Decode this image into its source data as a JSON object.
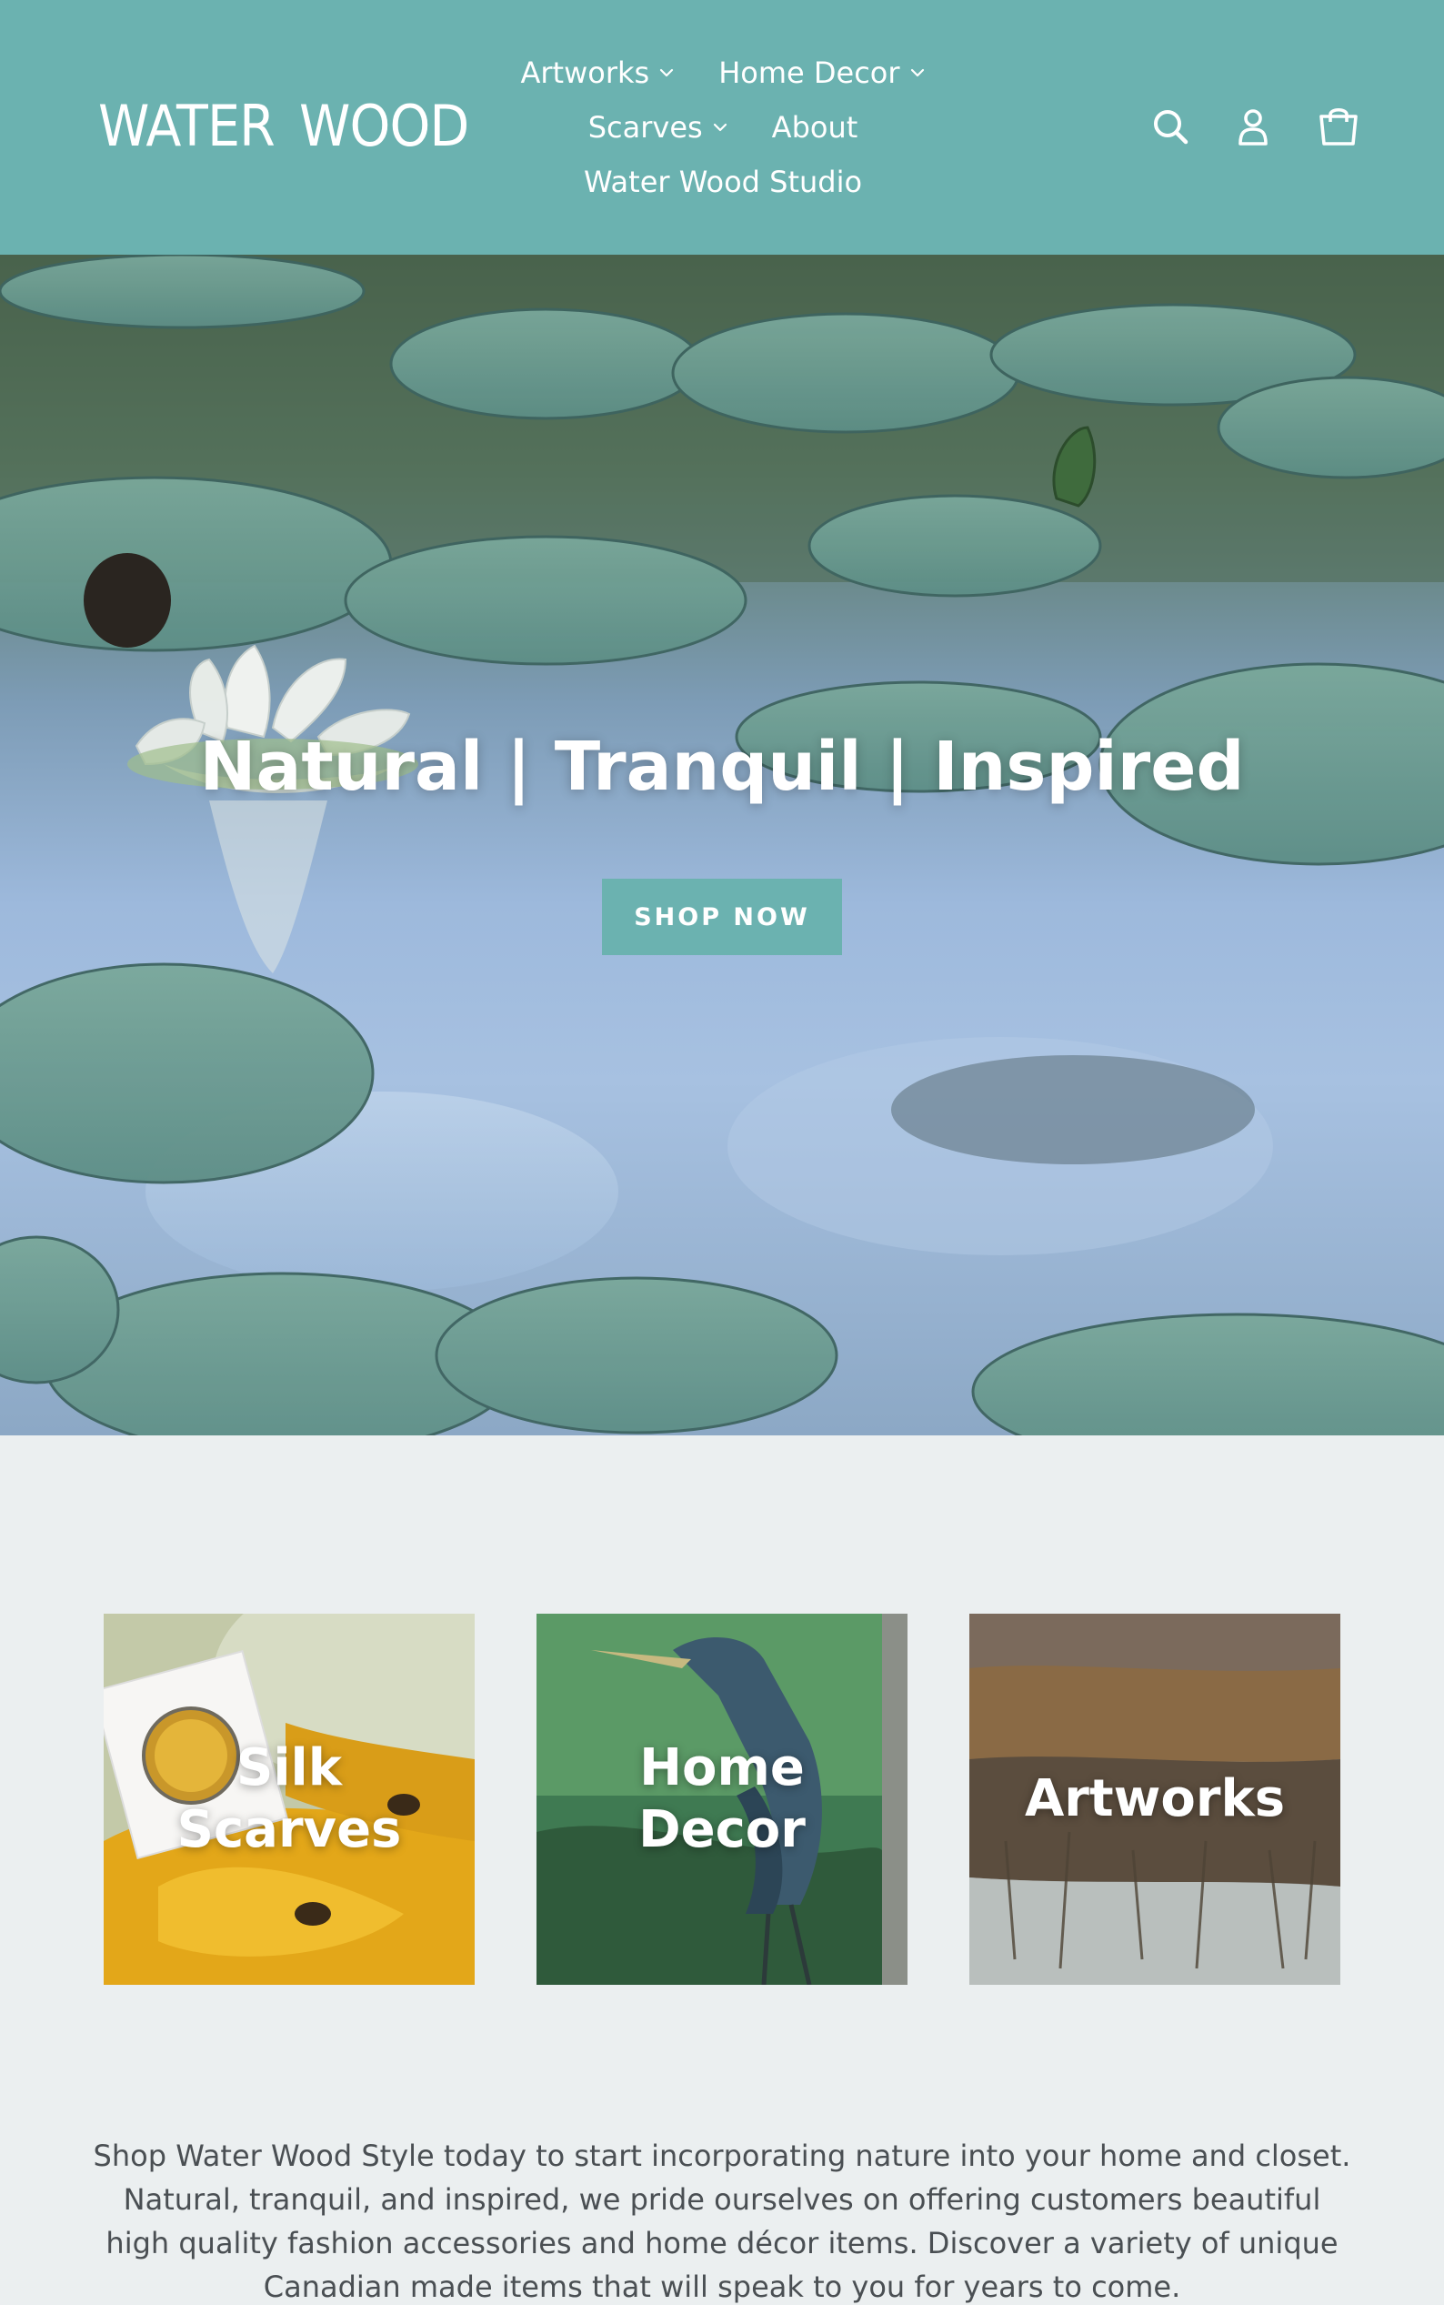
{
  "brand": {
    "logo_left": "WATER",
    "logo_right": "WOOD",
    "header_bg": "#6bb2b0"
  },
  "nav": {
    "items": [
      {
        "label": "Artworks",
        "has_dropdown": true
      },
      {
        "label": "Home Decor",
        "has_dropdown": true
      },
      {
        "label": "Scarves",
        "has_dropdown": true
      },
      {
        "label": "About",
        "has_dropdown": false
      },
      {
        "label": "Water Wood Studio",
        "has_dropdown": false
      }
    ],
    "icons": [
      "search-icon",
      "account-icon",
      "cart-icon"
    ]
  },
  "hero": {
    "title": "Natural | Tranquil | Inspired",
    "cta_label": "SHOP NOW",
    "cta_color": "#6bb2b0"
  },
  "collections": [
    {
      "label": "Silk Scarves"
    },
    {
      "label": "Home Decor"
    },
    {
      "label": "Artworks"
    }
  ],
  "intro": {
    "text": "Shop Water Wood Style today to start incorporating nature into your home and closet. Natural, tranquil, and inspired, we pride ourselves on offering customers beautiful high quality fashion accessories and home décor items. Discover a variety of unique Canadian made items that will speak to you for years to come."
  }
}
